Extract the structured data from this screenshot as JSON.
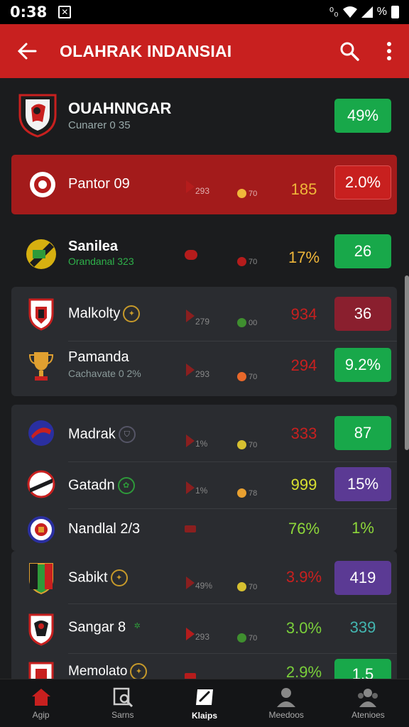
{
  "status": {
    "time": "0:38",
    "battery_text": "%"
  },
  "appbar": {
    "title": "OLAHRAK INDANSIAI"
  },
  "featured": {
    "name": "OUAHNNGAR",
    "sub": "Cunarer 0 35",
    "value": "49%",
    "value_color": "#18a84a"
  },
  "rows": [
    {
      "name": "Pantor 09",
      "small": "293",
      "dot_label": "70",
      "stat": "185",
      "stat_color": "#f0b73a",
      "pill": "2.0%",
      "pill_color": "#c8201f",
      "dot_color": "#f0b73a"
    },
    {
      "name": "Sanilea",
      "sub": "Orandanal 323",
      "sub_color": "#2eb14a",
      "small": "",
      "dot_label": "70",
      "stat": "17%",
      "stat_color": "#f0b73a",
      "pill": "26",
      "pill_color": "#18a84a",
      "dot_color": "#b51c1c"
    },
    {
      "name": "Malkolty",
      "small": "279",
      "dot_label": "00",
      "stat": "934",
      "stat_color": "#c8201f",
      "pill": "36",
      "pill_color": "#8a1f2e",
      "dot_color": "#3f8f2f"
    },
    {
      "name": "Pamanda",
      "sub": "Cachavate 0 2%",
      "sub_color": "#8a9a9a",
      "small": "293",
      "dot_label": "70",
      "stat": "294",
      "stat_color": "#c8201f",
      "pill": "9.2%",
      "pill_color": "#18a84a",
      "dot_color": "#e8682a"
    },
    {
      "name": "Madrak",
      "small": "1%",
      "dot_label": "70",
      "stat": "333",
      "stat_color": "#c8201f",
      "pill": "87",
      "pill_color": "#18a84a",
      "dot_color": "#d6c030"
    },
    {
      "name": "Gatadn",
      "small": "1%",
      "dot_label": "78",
      "stat": "999",
      "stat_color": "#d8e030",
      "pill": "15%",
      "pill_color": "#5b3a94",
      "dot_color": "#e8a030"
    },
    {
      "name": "Nandlal 2/3",
      "small": "",
      "dot_label": "",
      "stat": "76%",
      "stat_color": "#8ed83a",
      "pill": "1%",
      "pill_color": "transparent",
      "pill_text_color": "#8ed83a",
      "dot_color": ""
    },
    {
      "name": "Sabikt",
      "small": "49%",
      "dot_label": "70",
      "stat": "3.9%",
      "stat_color": "#c8201f",
      "pill": "419",
      "pill_color": "#5b3a94",
      "dot_color": "#d6c030"
    },
    {
      "name": "Sangar 8",
      "small": "293",
      "dot_label": "70",
      "stat": "3.0%",
      "stat_color": "#7ad03a",
      "pill": "339",
      "pill_color": "#2a2c30",
      "pill_text_color": "#43b6b0",
      "dot_color": "#3f8f2f"
    },
    {
      "name": "Memolato",
      "small": "",
      "dot_label": "",
      "stat": "2.9%",
      "stat_color": "#7ad03a",
      "pill": "1.5",
      "pill_color": "#18a84a",
      "dot_color": ""
    }
  ],
  "nav": [
    {
      "label": "Agip",
      "icon": "home-icon"
    },
    {
      "label": "Sarns",
      "icon": "document-search-icon"
    },
    {
      "label": "Klaips",
      "icon": "scoreboard-icon",
      "active": true
    },
    {
      "label": "Meedoos",
      "icon": "person-icon"
    },
    {
      "label": "Atenioes",
      "icon": "people-icon"
    }
  ]
}
